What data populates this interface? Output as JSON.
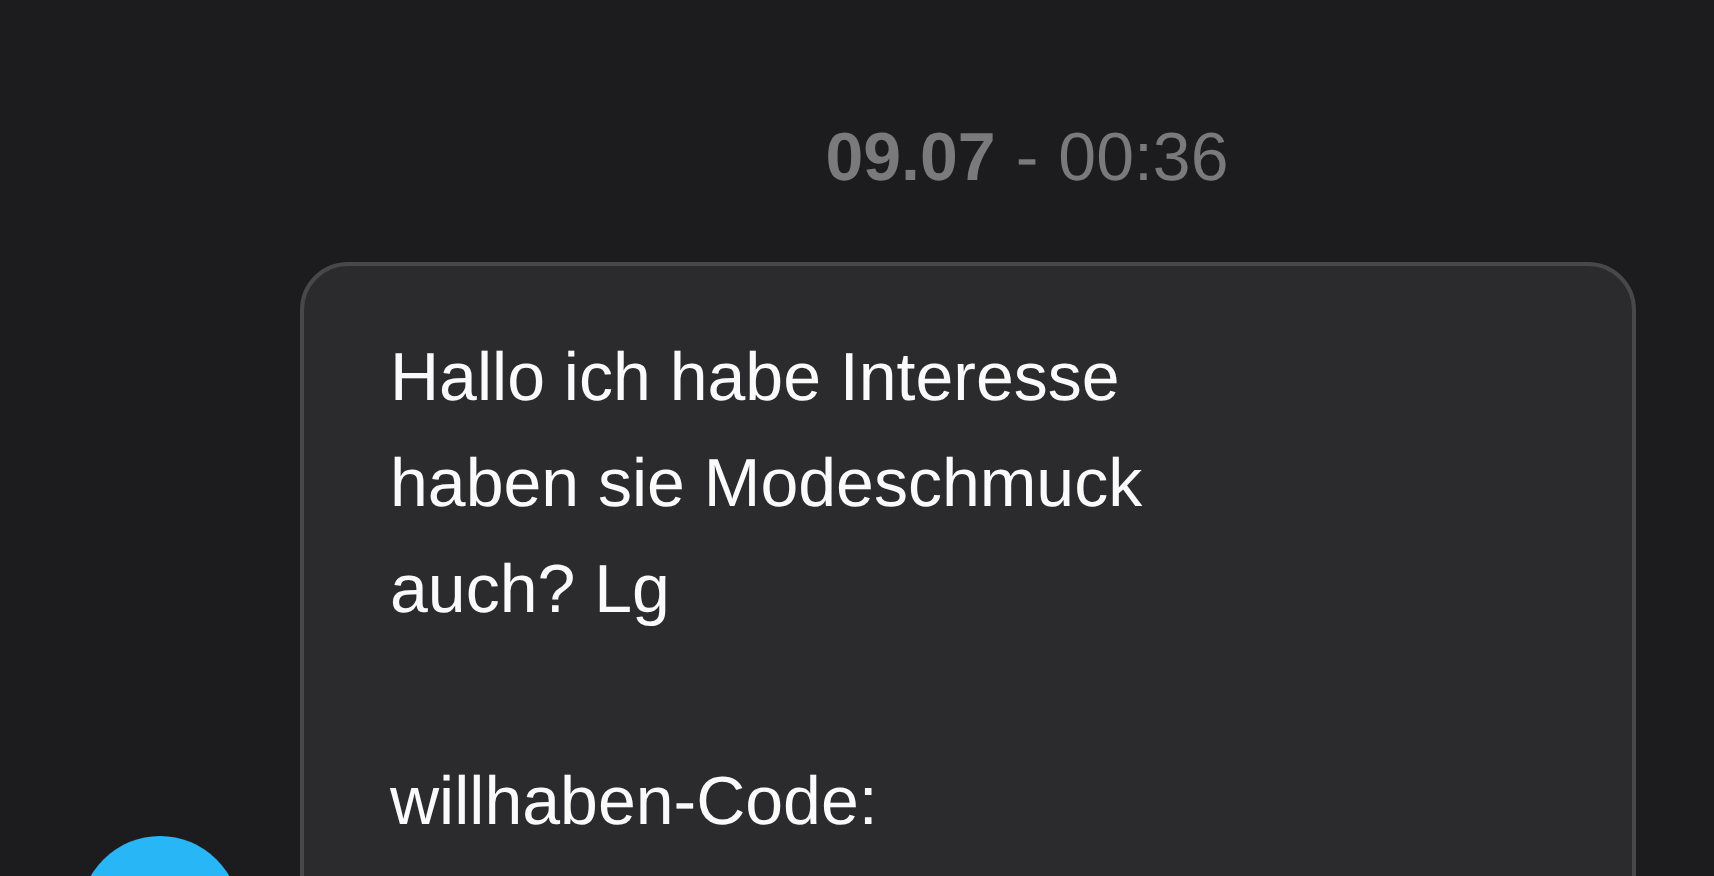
{
  "timestamp": {
    "date": "09.07",
    "separator": "-",
    "time": "00:36"
  },
  "message": {
    "text": "Hallo ich habe Interesse\nhaben sie Modeschmuck\nauch? Lg",
    "code_label": "willhaben-Code:"
  }
}
